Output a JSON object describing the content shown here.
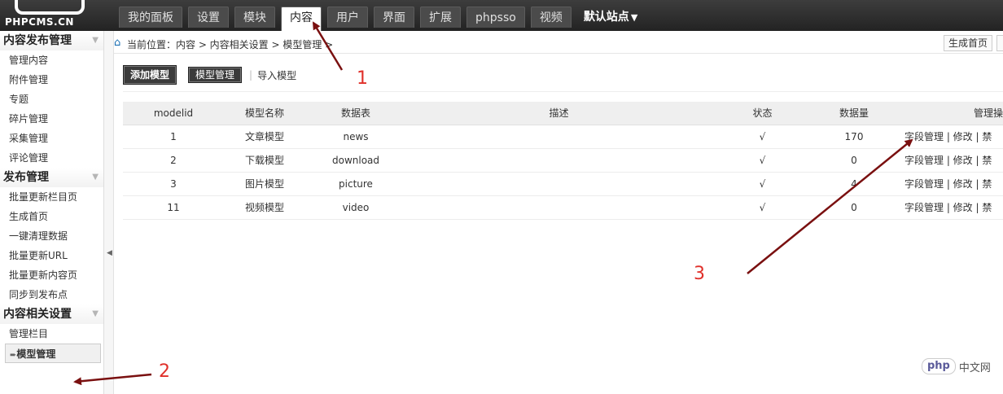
{
  "logo": {
    "text": "PHPCMS.CN"
  },
  "nav": {
    "tabs": [
      {
        "label": "我的面板",
        "active": false
      },
      {
        "label": "设置",
        "active": false
      },
      {
        "label": "模块",
        "active": false
      },
      {
        "label": "内容",
        "active": true
      },
      {
        "label": "用户",
        "active": false
      },
      {
        "label": "界面",
        "active": false
      },
      {
        "label": "扩展",
        "active": false
      },
      {
        "label": "phpsso",
        "active": false
      },
      {
        "label": "视频",
        "active": false
      }
    ],
    "site_label": "默认站点",
    "site_caret": "▼"
  },
  "sidebar": {
    "sections": [
      {
        "title": "内容发布管理",
        "items": [
          "管理内容",
          "附件管理",
          "专题",
          "碎片管理",
          "采集管理",
          "评论管理"
        ]
      },
      {
        "title": "发布管理",
        "items": [
          "批量更新栏目页",
          "生成首页",
          "一键清理数据",
          "批量更新URL",
          "批量更新内容页",
          "同步到发布点"
        ]
      },
      {
        "title": "内容相关设置",
        "items": [
          "管理栏目",
          "模型管理"
        ]
      }
    ],
    "current_item": "模型管理"
  },
  "breadcrumb": {
    "text": "当前位置：内容 > 内容相关设置 > 模型管理 >"
  },
  "toolbar": {
    "generate_home": "生成首页"
  },
  "subtabs": {
    "add_model": "添加模型",
    "model_manage": "模型管理",
    "sep": "|",
    "import_model": "导入模型"
  },
  "table": {
    "headers": [
      "modelid",
      "模型名称",
      "数据表",
      "描述",
      "状态",
      "数据量",
      "管理操"
    ],
    "rows": [
      {
        "id": "1",
        "name": "文章模型",
        "table": "news",
        "desc": "",
        "status": "√",
        "count": "170",
        "ops": "字段管理 | 修改 | 禁"
      },
      {
        "id": "2",
        "name": "下载模型",
        "table": "download",
        "desc": "",
        "status": "√",
        "count": "0",
        "ops": "字段管理 | 修改 | 禁"
      },
      {
        "id": "3",
        "name": "图片模型",
        "table": "picture",
        "desc": "",
        "status": "√",
        "count": "4",
        "ops": "字段管理 | 修改 | 禁"
      },
      {
        "id": "11",
        "name": "视频模型",
        "table": "video",
        "desc": "",
        "status": "√",
        "count": "0",
        "ops": "字段管理 | 修改 | 禁"
      }
    ]
  },
  "annotations": {
    "one": "1",
    "two": "2",
    "three": "3",
    "arrow_color": "#7a1010"
  },
  "watermark": {
    "badge": "php",
    "text": "中文网"
  }
}
